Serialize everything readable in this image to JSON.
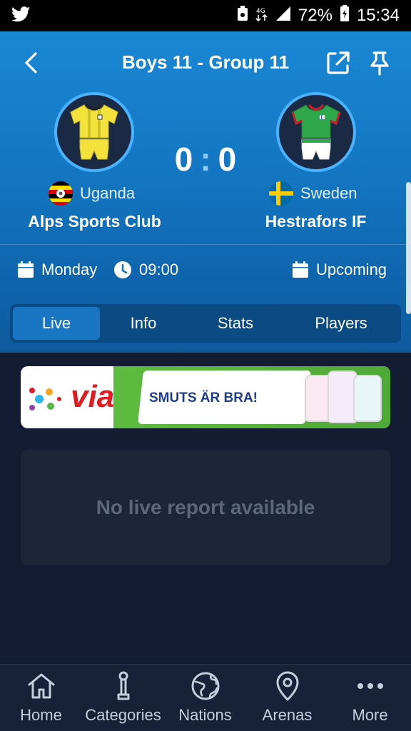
{
  "status_bar": {
    "battery": "72%",
    "time": "15:34",
    "icons": [
      "twitter-icon",
      "notification-icon",
      "data-icon",
      "signal-icon",
      "battery-icon"
    ]
  },
  "header": {
    "title": "Boys 11 - Group 11",
    "icons": [
      "back-arrow-icon",
      "external-link-icon",
      "pin-icon"
    ]
  },
  "match": {
    "home": {
      "country": "Uganda",
      "team": "Alps Sports Club",
      "jersey_colors": [
        "#f3e23b",
        "#1a1a1a"
      ]
    },
    "away": {
      "country": "Sweden",
      "team": "Hestrafors IF",
      "jersey_colors": [
        "#2ea84a",
        "#c81e2a"
      ]
    },
    "score_home": "0",
    "score_separator": ":",
    "score_away": "0",
    "day": "Monday",
    "time": "09:00",
    "status": "Upcoming"
  },
  "tabs": [
    {
      "label": "Live",
      "active": true
    },
    {
      "label": "Info",
      "active": false
    },
    {
      "label": "Stats",
      "active": false
    },
    {
      "label": "Players",
      "active": false
    }
  ],
  "ad": {
    "brand": "via",
    "slogan": "SMUTS ÄR BRA!"
  },
  "live_report": {
    "empty_message": "No live report available"
  },
  "bottom_nav": [
    {
      "label": "Home",
      "icon": "home-icon"
    },
    {
      "label": "Categories",
      "icon": "trophy-icon"
    },
    {
      "label": "Nations",
      "icon": "globe-icon"
    },
    {
      "label": "Arenas",
      "icon": "location-pin-icon"
    },
    {
      "label": "More",
      "icon": "more-dots-icon"
    }
  ],
  "colors": {
    "header_blue": "#1478c4",
    "background": "#131c33",
    "accent_light_blue": "#4ab3ff",
    "active_tab": "#1976c2"
  }
}
